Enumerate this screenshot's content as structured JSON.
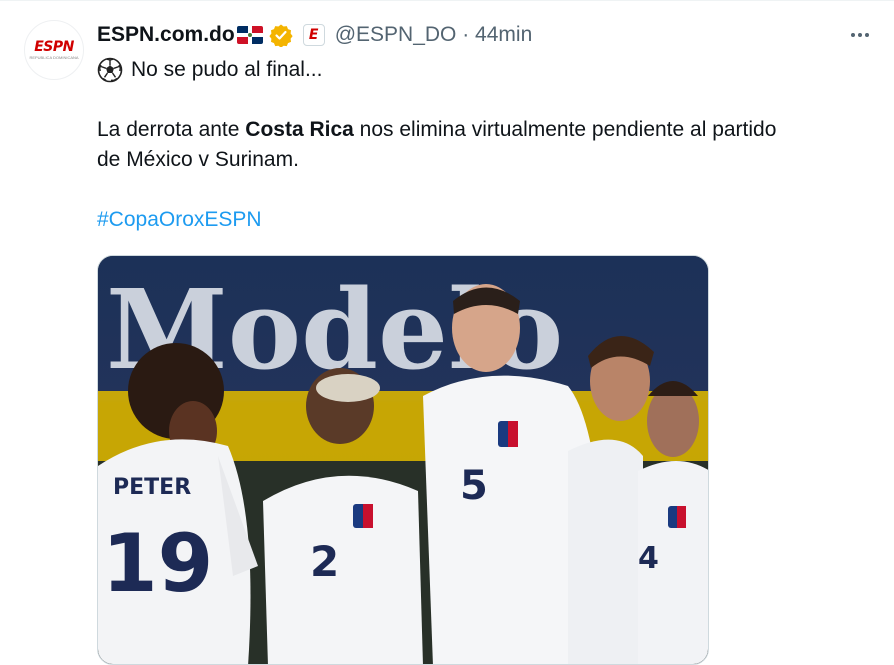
{
  "tweet": {
    "display_name": "ESPN.com.do",
    "handle_time": "@ESPN_DO · 44min",
    "avatar": {
      "logo": "ESPN",
      "subtitle": "REPUBLICA DOMINICANA"
    },
    "affiliate_badge": "E",
    "line1": "No se pudo al final...",
    "line2_before": "La derrota ante ",
    "line2_bold": "Costa Rica",
    "line2_after": " nos elimina virtualmente pendiente al partido",
    "line3": "de México v Surinam.",
    "hashtag": "#CopaOroxESPN",
    "icons": [
      "dominican-flag-icon",
      "verified-badge-icon",
      "soccer-ball-icon",
      "more-options-icon"
    ]
  },
  "photo": {
    "banner_text": "Modelo",
    "jersey_name": "PETER",
    "numbers": [
      "19",
      "5",
      "2",
      "4"
    ]
  },
  "colors": {
    "link": "#1d9bf0",
    "secondary": "#536471",
    "espn_red": "#d00000",
    "verified_gold": "#f4b400"
  }
}
